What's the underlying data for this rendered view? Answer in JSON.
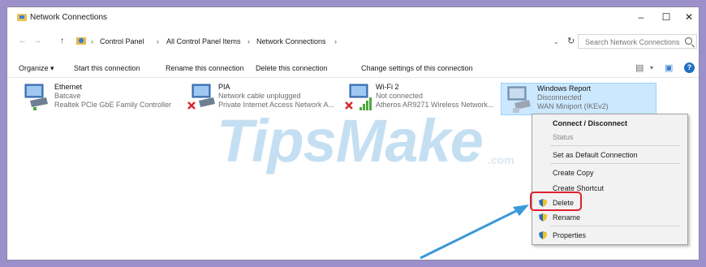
{
  "window": {
    "title": "Network Connections",
    "minimize": "–",
    "maximize": "☐",
    "close": "✕"
  },
  "address": {
    "back": "←",
    "forward": "→",
    "up": "↑",
    "crumbs": [
      "Control Panel",
      "All Control Panel Items",
      "Network Connections"
    ],
    "separator": "›",
    "dropdown": "⌄",
    "refresh": "↻",
    "search_placeholder": "Search Network Connections"
  },
  "commands": {
    "organize": "Organize ▾",
    "start": "Start this connection",
    "rename": "Rename this connection",
    "delete": "Delete this connection",
    "settings": "Change settings of this connection",
    "help": "?"
  },
  "connections": [
    {
      "name": "Ethernet",
      "status": "Batcave",
      "device": "Realtek PCIe GbE Family Controller"
    },
    {
      "name": "PIA",
      "status": "Network cable unplugged",
      "device": "Private Internet Access Network A..."
    },
    {
      "name": "Wi-Fi 2",
      "status": "Not connected",
      "device": "Atheros AR9271 Wireless Network..."
    },
    {
      "name": "Windows Report",
      "status": "Disconnected",
      "device": "WAN Miniport (IKEv2)"
    }
  ],
  "context_menu": {
    "connect": "Connect / Disconnect",
    "status": "Status",
    "default": "Set as Default Connection",
    "copy": "Create Copy",
    "shortcut": "Create Shortcut",
    "delete": "Delete",
    "rename": "Rename",
    "properties": "Properties"
  },
  "watermark": {
    "main": "TipsMake",
    "suffix": ".com"
  },
  "colors": {
    "selection": "#cce8ff",
    "highlight": "#e02030",
    "arrow": "#3a9ad9",
    "frame": "#9b90c9"
  }
}
